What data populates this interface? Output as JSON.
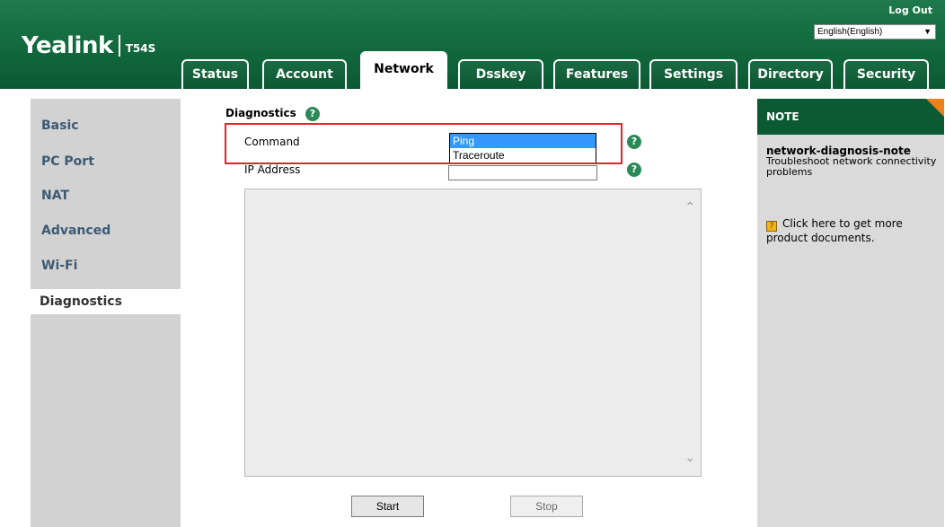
{
  "header": {
    "brand": "Yealink",
    "model": "T54S",
    "logout_label": "Log Out",
    "language_selected": "English(English)",
    "tabs": [
      {
        "label": "Status"
      },
      {
        "label": "Account"
      },
      {
        "label": "Network",
        "active": true
      },
      {
        "label": "Dsskey"
      },
      {
        "label": "Features"
      },
      {
        "label": "Settings"
      },
      {
        "label": "Directory"
      },
      {
        "label": "Security"
      }
    ]
  },
  "sidebar": {
    "items": [
      {
        "label": "Basic"
      },
      {
        "label": "PC Port"
      },
      {
        "label": "NAT"
      },
      {
        "label": "Advanced"
      },
      {
        "label": "Wi-Fi"
      },
      {
        "label": "Diagnostics",
        "active": true
      }
    ]
  },
  "main": {
    "section_title": "Diagnostics",
    "command_label": "Command",
    "ip_label": "IP Address",
    "ip_value": "",
    "command_options": [
      "Ping",
      "Traceroute"
    ],
    "command_selected": "Ping",
    "start_label": "Start",
    "stop_label": "Stop",
    "help_glyph": "?"
  },
  "note": {
    "header": "NOTE",
    "title": "network-diagnosis-note",
    "text": "Troubleshoot network connectivity problems",
    "doc_link": "Click here to get more product documents."
  },
  "colors": {
    "brand_green": "#0c5a33",
    "accent_orange": "#f0801a",
    "sidebar_link": "#3d5a73",
    "highlight_red": "#e0262c",
    "selection_blue": "#3399ff"
  }
}
